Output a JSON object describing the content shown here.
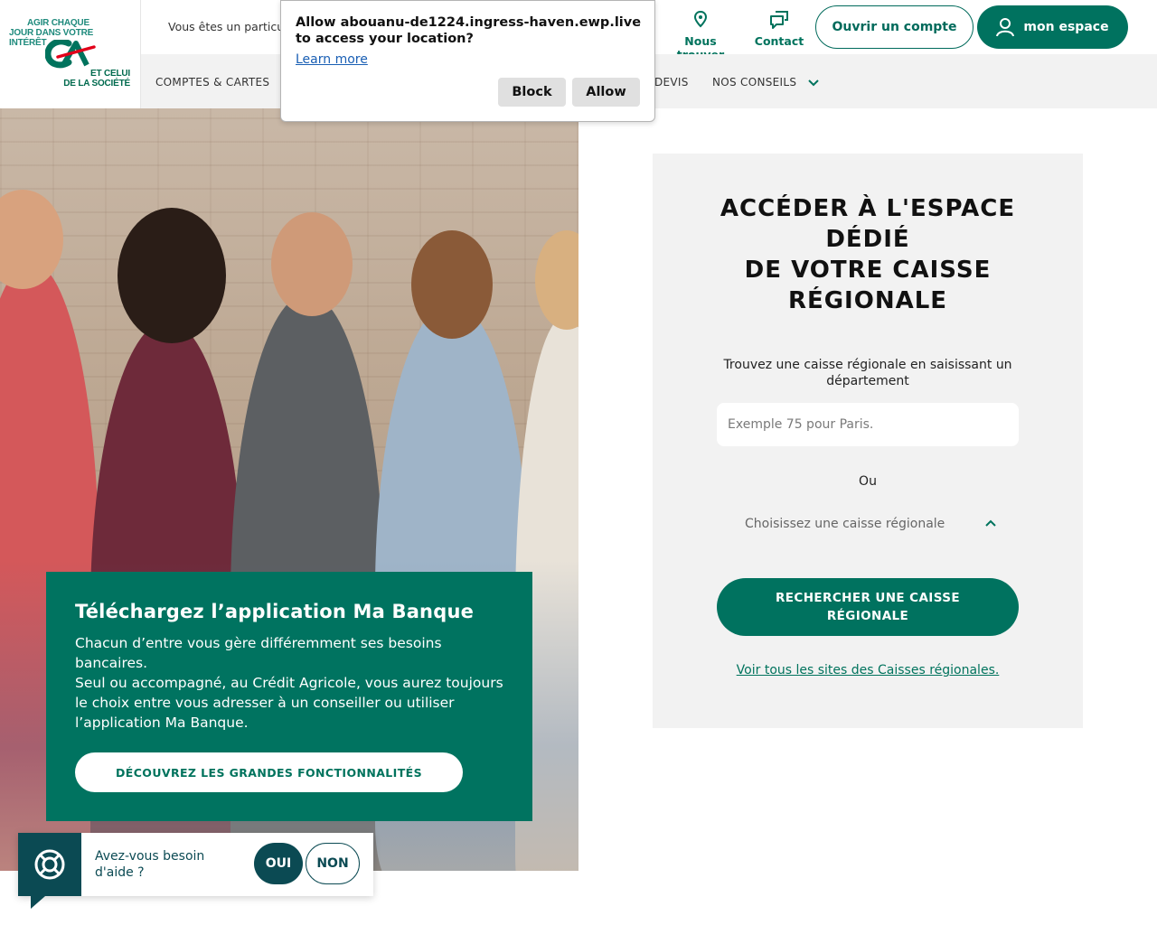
{
  "permission_prompt": {
    "message": "Allow abouanu-de1224.ingress-haven.ewp.live to access your location?",
    "learn_more": "Learn more",
    "block_label": "Block",
    "allow_label": "Allow"
  },
  "logo": {
    "slogan_top": [
      "AGIR CHAQUE",
      "JOUR DANS VOTRE",
      "INTÉRÊT"
    ],
    "slogan_bottom": [
      "ET CELUI",
      "DE LA SOCIÉTÉ"
    ],
    "colors": {
      "green": "#00735d",
      "red": "#e2001a",
      "teal": "#1e8a7c"
    }
  },
  "header": {
    "visitor_text": "Vous êtes un particul",
    "find_us": "Nous trouver",
    "contact": "Contact",
    "open_account": "Ouvrir un compte",
    "my_space": "mon espace"
  },
  "nav": {
    "items": [
      "COMPTES & CARTES",
      "DEVIS",
      "NOS CONSEILS"
    ]
  },
  "promo": {
    "title": "Téléchargez l’application Ma Banque",
    "line1": "Chacun d’entre vous gère différemment ses besoins bancaires.",
    "line2": "Seul ou accompagné, au Crédit Agricole, vous aurez toujours le choix entre vous adresser à un conseiller ou utiliser l’application Ma Banque.",
    "button": "DÉCOUVREZ LES GRANDES FONCTIONNALITÉS"
  },
  "help_widget": {
    "question": "Avez-vous besoin d'aide ?",
    "yes": "OUI",
    "no": "NON"
  },
  "panel": {
    "title_line1": "ACCÉDER À L'ESPACE DÉDIÉ",
    "title_line2": "DE VOTRE CAISSE RÉGIONALE",
    "instructions": "Trouvez une caisse régionale en saisissant un département",
    "input_placeholder": "Exemple 75 pour Paris.",
    "or": "Ou",
    "select_value": "Choisissez une caisse régionale",
    "search_button": "RECHERCHER UNE CAISSE RÉGIONALE",
    "all_sites_link": "Voir tous les sites des Caisses régionales."
  },
  "colors": {
    "brand_green": "#00725f",
    "help_teal": "#0b4a53",
    "panel_bg": "#f2f2f2"
  }
}
